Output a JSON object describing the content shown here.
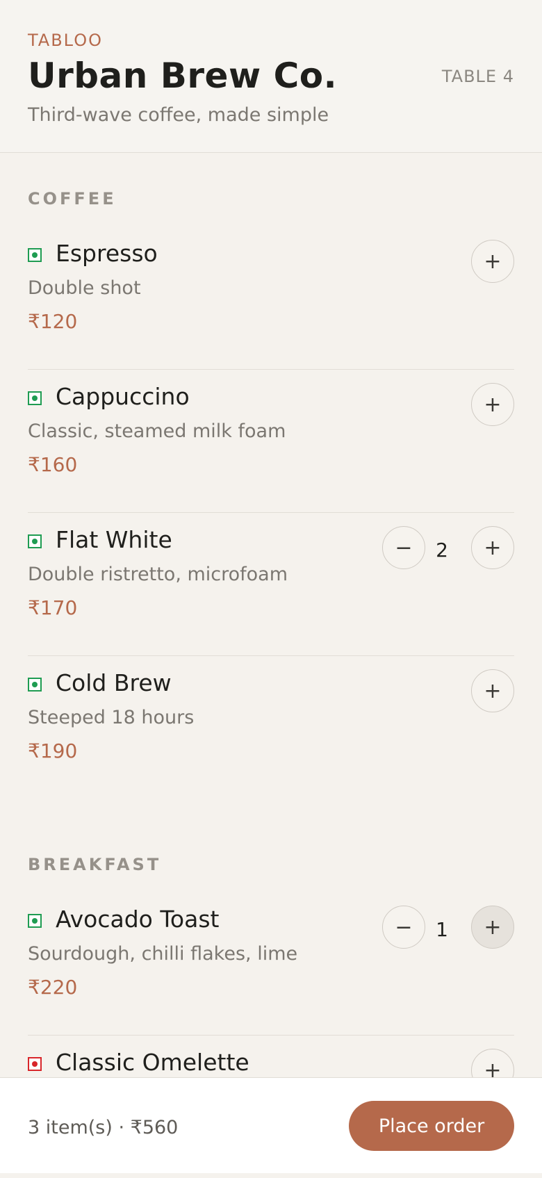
{
  "header": {
    "brand": "TABLOO",
    "title": "Urban Brew Co.",
    "subtitle": "Third-wave coffee, made simple",
    "table_label": "TABLE 4"
  },
  "sections": [
    {
      "title": "COFFEE",
      "items": [
        {
          "name": "Espresso",
          "description": "Double shot",
          "price": "₹120",
          "veg": true,
          "quantity": null
        },
        {
          "name": "Cappuccino",
          "description": "Classic, steamed milk foam",
          "price": "₹160",
          "veg": true,
          "quantity": null
        },
        {
          "name": "Flat White",
          "description": "Double ristretto, microfoam",
          "price": "₹170",
          "veg": true,
          "quantity": "2"
        },
        {
          "name": "Cold Brew",
          "description": "Steeped 18 hours",
          "price": "₹190",
          "veg": true,
          "quantity": null
        }
      ]
    },
    {
      "title": "BREAKFAST",
      "items": [
        {
          "name": "Avocado Toast",
          "description": "Sourdough, chilli flakes, lime",
          "price": "₹220",
          "veg": true,
          "quantity": "1"
        },
        {
          "name": "Classic Omelette",
          "description": "",
          "price": "",
          "veg": false,
          "quantity": null
        }
      ]
    }
  ],
  "controls": {
    "plus": "+",
    "minus": "−"
  },
  "footer": {
    "summary": "3 item(s) · ₹560",
    "place_order_label": "Place order"
  },
  "colors": {
    "accent": "#b5694b",
    "veg": "#1f9c52",
    "non_veg": "#d8262a",
    "background": "#f5f2ed"
  }
}
